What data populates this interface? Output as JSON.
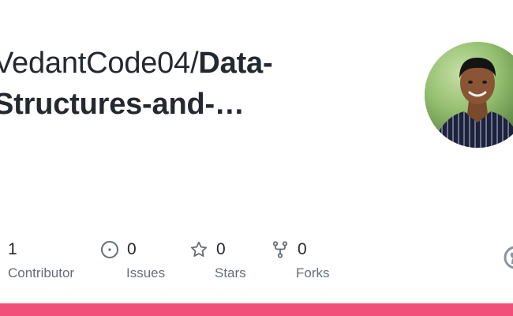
{
  "repo": {
    "owner": "VedantCode04",
    "separator": "/",
    "name_line1": "Data-",
    "name_line2": "Structures-and-…"
  },
  "stats": {
    "contributors": {
      "value": "1",
      "label": "Contributor"
    },
    "issues": {
      "value": "0",
      "label": "Issues",
      "icon": "issue-opened-icon"
    },
    "stars": {
      "value": "0",
      "label": "Stars",
      "icon": "star-icon"
    },
    "forks": {
      "value": "0",
      "label": "Forks",
      "icon": "repo-forked-icon"
    }
  },
  "colors": {
    "language_bar": "#f1507a",
    "text": "#24292f",
    "muted": "#656d76"
  }
}
